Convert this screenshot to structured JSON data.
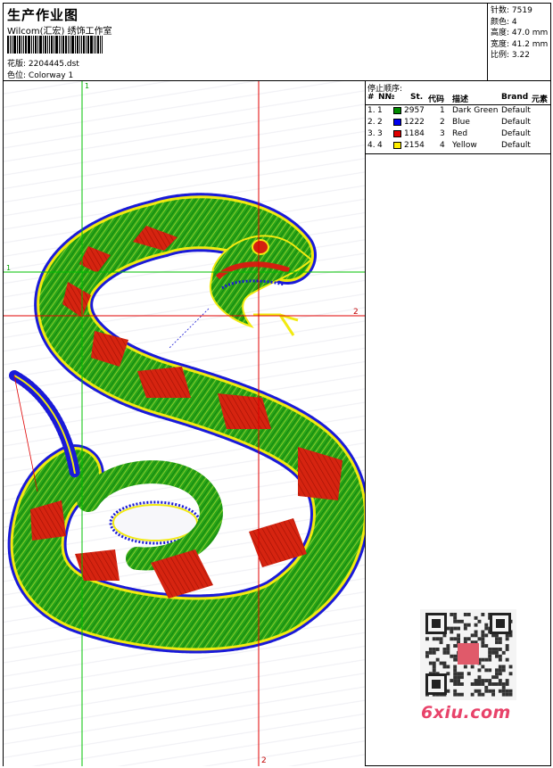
{
  "header": {
    "title": "生产作业图",
    "subtitle": "Wilcom(汇宏) 绣饰工作室",
    "design_label": "花版:",
    "design_value": "2204445.dst",
    "color_label": "色位:",
    "color_value": "Colorway 1"
  },
  "stats": {
    "stitches": "针数: 7519",
    "colors": "颜色: 4",
    "height": "高度: 47.0 mm",
    "width": "宽度: 41.2 mm",
    "ratio": "比例: 3.22"
  },
  "guides": {
    "v1_label": "1",
    "h1_label": "1",
    "h2_label": "2",
    "v2_label": "2"
  },
  "stop_sequence": {
    "title": "停止顺序:",
    "headers": [
      "#",
      "N№",
      "St.",
      "代码",
      "描述",
      "Brand",
      "元素"
    ],
    "rows": [
      {
        "idx": "1.",
        "n": "1",
        "color": "#008a00",
        "st": "2957",
        "code": "1",
        "desc": "Dark Green",
        "brand": "Default"
      },
      {
        "idx": "2.",
        "n": "2",
        "color": "#0000ee",
        "st": "1222",
        "code": "2",
        "desc": "Blue",
        "brand": "Default"
      },
      {
        "idx": "3.",
        "n": "3",
        "color": "#e00000",
        "st": "1184",
        "code": "3",
        "desc": "Red",
        "brand": "Default"
      },
      {
        "idx": "4.",
        "n": "4",
        "color": "#ffee00",
        "st": "2154",
        "code": "4",
        "desc": "Yellow",
        "brand": "Default"
      }
    ]
  },
  "watermark": {
    "logo_text": "6xiu.com"
  },
  "colors": {
    "green": "#1e9a10",
    "blue": "#1a1ad8",
    "red": "#d42010",
    "yellow": "#f2ea10",
    "guide_green": "#00c000",
    "guide_red": "#e00000"
  }
}
